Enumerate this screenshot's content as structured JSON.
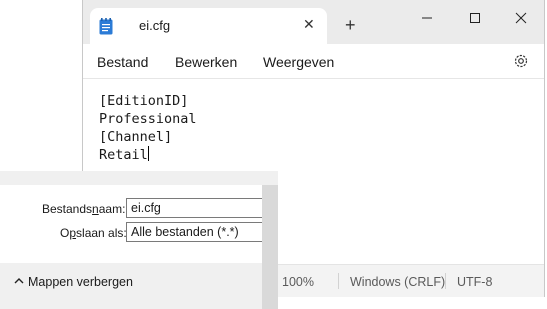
{
  "tab": {
    "title": "ei.cfg",
    "close_glyph": "✕",
    "add_glyph": "+"
  },
  "window_controls": {
    "minimize": "minimize-icon",
    "maximize": "maximize-icon",
    "close": "close-icon"
  },
  "menu": {
    "items": [
      "Bestand",
      "Bewerken",
      "Weergeven"
    ],
    "settings_icon": "gear-icon"
  },
  "editor": {
    "lines": [
      "[EditionID]",
      "Professional",
      "[Channel]",
      "Retail"
    ]
  },
  "status": {
    "zoom": "100%",
    "line_endings": "Windows (CRLF)",
    "encoding": "UTF-8"
  },
  "save_dialog": {
    "filename_label_pre": "Bestands",
    "filename_label_key": "n",
    "filename_label_post": "aam:",
    "filename_value": "ei.cfg",
    "type_label_pre": "O",
    "type_label_key": "p",
    "type_label_post": "slaan als:",
    "type_value": "Alle bestanden  (*.*)",
    "hide_folders": "Mappen verbergen"
  },
  "colors": {
    "titlebar": "#ebebeb",
    "accent_icon": "#2b7bd6"
  }
}
